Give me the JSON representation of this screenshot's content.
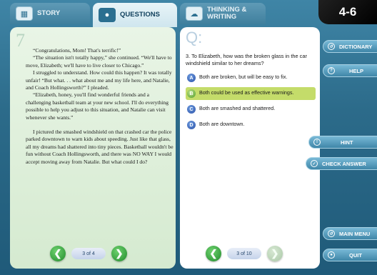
{
  "tabs": [
    {
      "label": "STORY",
      "icon": "book-icon"
    },
    {
      "label": "QUESTIONS",
      "icon": "people-icon"
    },
    {
      "label": "THINKING & WRITING",
      "icon": "thought-bubble-icon"
    }
  ],
  "lesson_number": "4-6",
  "story": {
    "page_number": "7",
    "paragraphs": [
      "“Congratulations, Mom! That's terrific!”",
      "“The situation isn't totally happy,” she continued. “We'll have to move, Elizabeth; we'll have to live closer to Chicago.”",
      "I struggled to understand. How could this happen? It was totally unfair! “But what. . . what about me and my life here, and Natalie, and Coach Hollingsworth?” I pleaded.",
      "“Elizabeth, honey, you'll find wonderful friends and a challenging basketball team at your new school. I'll do everything possible to help you adjust to this situation, and Natalie can visit whenever she wants.”",
      "I pictured the smashed windshield on that crashed car the police parked downtown to warn kids about speeding. Just like that glass, all my dreams had shattered into tiny pieces. Basketball wouldn't be fun without Coach Hollingsworth, and there was NO WAY I would accept moving away from Natalie. But what could I do?"
    ],
    "pager": "3 of 4"
  },
  "question": {
    "label": "Q:",
    "text": "3. To Elizabeth, how was the broken glass in the car windshield similar to her dreams?",
    "answers": [
      {
        "letter": "A",
        "text": "Both are broken, but will be easy to fix."
      },
      {
        "letter": "B",
        "text": "Both could be used as effective warnings."
      },
      {
        "letter": "C",
        "text": "Both are smashed and shattered."
      },
      {
        "letter": "D",
        "text": "Both are downtown."
      }
    ],
    "selected": "B",
    "pager": "3 of 10"
  },
  "buttons": {
    "dictionary": "DICTIONARY",
    "help": "HELP",
    "hint": "HINT",
    "check_answer": "CHECK ANSWER",
    "main_menu": "MAIN MENU",
    "quit": "QUIT"
  },
  "colors": {
    "selected_answer": "#c4dc6a",
    "nav_green": "#1f8a2a",
    "answer_blue": "#2a4fa6"
  }
}
